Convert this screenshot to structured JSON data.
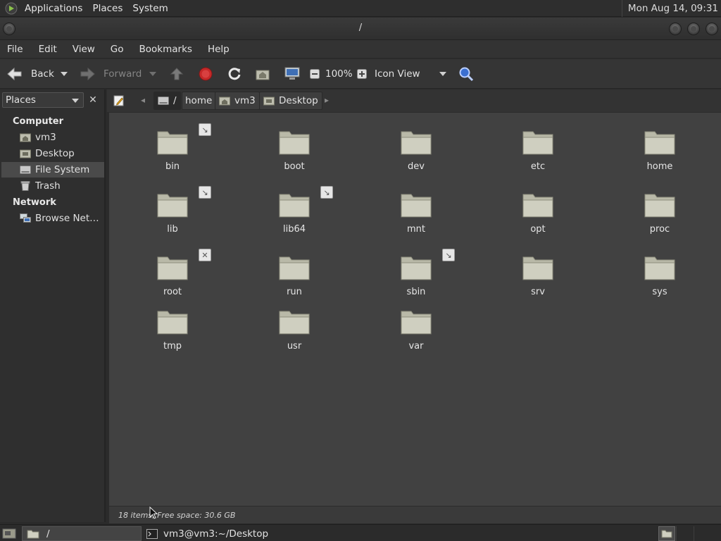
{
  "top_panel": {
    "menus": [
      "Applications",
      "Places",
      "System"
    ],
    "clock": "Mon Aug 14, 09:31"
  },
  "window": {
    "title": "/"
  },
  "menubar": [
    "File",
    "Edit",
    "View",
    "Go",
    "Bookmarks",
    "Help"
  ],
  "toolbar": {
    "back": "Back",
    "forward": "Forward",
    "zoom": "100%",
    "view_mode": "Icon View"
  },
  "sidebar": {
    "selector": "Places",
    "computer_heading": "Computer",
    "computer_items": [
      {
        "label": "vm3",
        "icon": "home-folder-icon"
      },
      {
        "label": "Desktop",
        "icon": "desktop-folder-icon"
      },
      {
        "label": "File System",
        "icon": "drive-icon"
      },
      {
        "label": "Trash",
        "icon": "trash-icon"
      }
    ],
    "network_heading": "Network",
    "network_items": [
      {
        "label": "Browse Net…",
        "icon": "network-icon"
      }
    ]
  },
  "pathbar": {
    "crumbs": [
      "/",
      "home",
      "vm3",
      "Desktop"
    ]
  },
  "files": [
    {
      "name": "bin",
      "emblem": "symlink"
    },
    {
      "name": "boot",
      "emblem": ""
    },
    {
      "name": "dev",
      "emblem": ""
    },
    {
      "name": "etc",
      "emblem": ""
    },
    {
      "name": "home",
      "emblem": ""
    },
    {
      "name": "lib",
      "emblem": "symlink"
    },
    {
      "name": "lib64",
      "emblem": "symlink"
    },
    {
      "name": "mnt",
      "emblem": ""
    },
    {
      "name": "opt",
      "emblem": ""
    },
    {
      "name": "proc",
      "emblem": ""
    },
    {
      "name": "root",
      "emblem": "no-access"
    },
    {
      "name": "run",
      "emblem": ""
    },
    {
      "name": "sbin",
      "emblem": "symlink"
    },
    {
      "name": "srv",
      "emblem": ""
    },
    {
      "name": "sys",
      "emblem": ""
    },
    {
      "name": "tmp",
      "emblem": ""
    },
    {
      "name": "usr",
      "emblem": ""
    },
    {
      "name": "var",
      "emblem": ""
    }
  ],
  "status": "18 items, Free space: 30.6 GB",
  "taskbar": {
    "tasks": [
      "/",
      "vm3@vm3:~/Desktop"
    ]
  },
  "colors": {
    "folder_body": "#cfcfc0",
    "folder_tab": "#b9b9a8",
    "stop_red": "#c62828",
    "main_bg": "#414141"
  }
}
